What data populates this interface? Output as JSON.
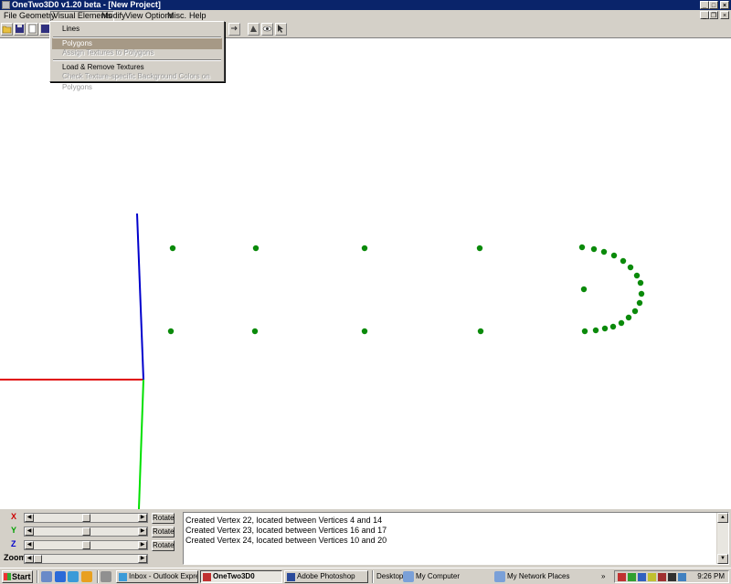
{
  "window": {
    "title": "OneTwo3D0 v1.20 beta - [New Project]"
  },
  "title_buttons": {
    "minimize": "_",
    "maximize": "□",
    "close": "×"
  },
  "mdi_buttons": {
    "minimize": "_",
    "restore": "❐",
    "close": "×"
  },
  "menubar": [
    "File",
    "Geometry",
    "Visual Elements",
    "Modify",
    "View Options",
    "Misc.",
    "Help"
  ],
  "dropdown": {
    "items": [
      {
        "label": "Lines",
        "state": "normal"
      },
      {
        "label": "Polygons",
        "state": "highlighted"
      },
      {
        "label": "Assign Textures to Polygons",
        "state": "disabled"
      },
      {
        "label": "Load & Remove Textures",
        "state": "normal"
      },
      {
        "label": "Check Texture-specific Background Colors on Polygons",
        "state": "disabled"
      }
    ]
  },
  "controls": {
    "axes": [
      {
        "label": "X",
        "color": "#cc0000",
        "button": "Rotate",
        "level": 0.5
      },
      {
        "label": "Y",
        "color": "#00a000",
        "button": "Rotate",
        "level": 0.5
      },
      {
        "label": "Z",
        "color": "#0000cc",
        "button": "Rotate",
        "level": 0.5
      }
    ],
    "zoom_label": "Zoom",
    "zoom_level": 0.0
  },
  "log": [
    "Created Vertex 22, located between Vertices 4 and 14",
    "Created Vertex 23, located between Vertices 16 and 17",
    "Created Vertex 24, located between Vertices 10 and 20"
  ],
  "taskbar": {
    "start": "Start",
    "tasks": [
      "Inbox - Outlook Express",
      "OneTwo3D0",
      "Adobe Photoshop"
    ],
    "desk_items": [
      "Desktop",
      "My Computer",
      "My Network Places"
    ],
    "clock": "9:26 PM"
  },
  "colors": {
    "axis_x": "#e00000",
    "axis_y": "#00e000",
    "axis_z": "#0000cc",
    "vertex": "#0a8a0a"
  }
}
